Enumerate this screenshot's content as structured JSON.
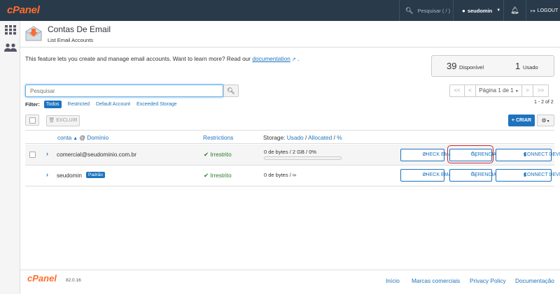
{
  "topbar": {
    "logo": "cPanel",
    "search_placeholder": "Pesquisar ( / )",
    "username": "seudomin",
    "logout_label": "LOGOUT"
  },
  "header": {
    "title": "Contas De Email",
    "subtitle": "List Email Accounts"
  },
  "intro": {
    "text": "This feature lets you create and manage email accounts. Want to learn more? Read our",
    "link": "documentation",
    "tail": "."
  },
  "stats": {
    "available_value": "39",
    "available_label": "Disponível",
    "used_value": "1",
    "used_label": "Usado"
  },
  "search": {
    "placeholder": "Pesquisar"
  },
  "pager": {
    "first": "<<",
    "prev": "<",
    "page_label": "Página 1 de 1",
    "next": ">",
    "last": ">>",
    "count": "1 - 2 of 2"
  },
  "filter": {
    "label": "Filter:",
    "options": [
      "Todos",
      "Restricted",
      "Default Account",
      "Exceeded Storage"
    ]
  },
  "toolbar": {
    "delete_label": "EXCLUIR",
    "create_label": "CRIAR"
  },
  "table": {
    "col_account": "conta",
    "col_domain": "Domínio",
    "col_restrictions": "Restrictions",
    "col_storage_prefix": "Storage:",
    "col_used": "Usado",
    "col_allocated": "Allocated",
    "col_percent": "%",
    "rows": [
      {
        "account": "comercial@seudominio.com.br",
        "badge": "",
        "restriction": "Irrestrito",
        "storage": "0 de bytes / 2 GB / 0%",
        "usage_percent": 0
      },
      {
        "account": "seudomin",
        "badge": "Padrão",
        "restriction": "Irrestrito",
        "storage": "0 de bytes / ∞",
        "usage_percent": null
      }
    ],
    "actions": {
      "check_email": "CHECK EMAIL",
      "manage": "GERENCIAR",
      "connect": "CONNECT DEVICES"
    }
  },
  "footer": {
    "logo": "cPanel",
    "version": "82.0.16",
    "links": [
      "Início",
      "Marcas comerciais",
      "Privacy Policy",
      "Documentação"
    ]
  },
  "colors": {
    "topbar": "#293a4a",
    "brand": "#ff6c2c",
    "accent": "#1d73be",
    "success": "#2a7a2a",
    "highlight": "#d9232e"
  }
}
